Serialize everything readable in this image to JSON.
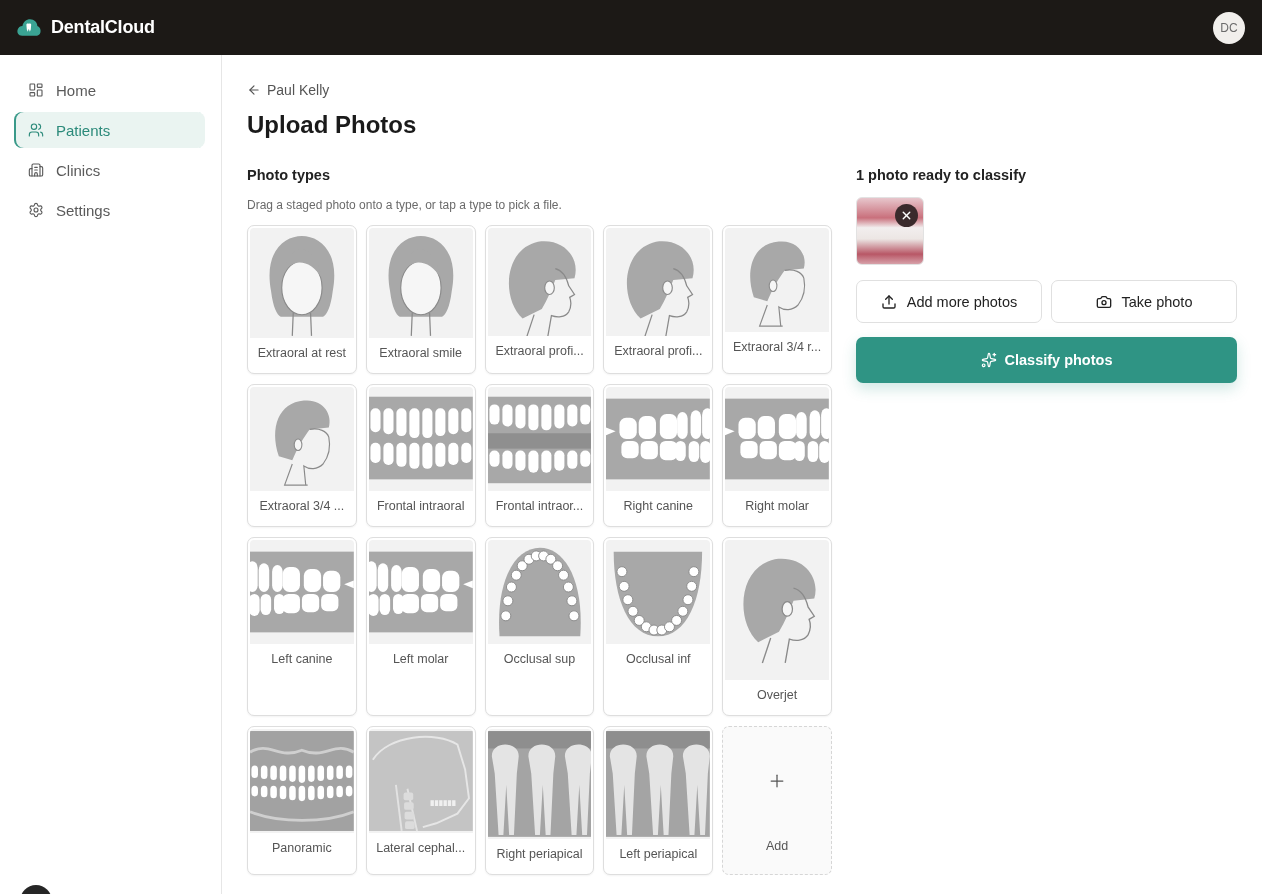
{
  "app": {
    "name": "DentalCloud",
    "user_initials": "DC"
  },
  "sidebar": {
    "items": [
      {
        "label": "Home",
        "selected": false
      },
      {
        "label": "Patients",
        "selected": true
      },
      {
        "label": "Clinics",
        "selected": false
      },
      {
        "label": "Settings",
        "selected": false
      }
    ]
  },
  "page": {
    "back_link": "Paul Kelly",
    "title": "Upload Photos"
  },
  "photo_types": {
    "heading": "Photo types",
    "hint": "Drag a staged photo onto a type, or tap a type to pick a file.",
    "tiles": [
      {
        "label": "Extraoral at rest",
        "kind": "face-front"
      },
      {
        "label": "Extraoral smile",
        "kind": "face-front"
      },
      {
        "label": "Extraoral profi...",
        "kind": "face-profile"
      },
      {
        "label": "Extraoral profi...",
        "kind": "face-profile"
      },
      {
        "label": "Extraoral 3/4 r...",
        "kind": "face-three-quarter"
      },
      {
        "label": "Extraoral 3/4 ...",
        "kind": "face-three-quarter"
      },
      {
        "label": "Frontal intraoral",
        "kind": "teeth-front"
      },
      {
        "label": "Frontal intraor...",
        "kind": "teeth-open"
      },
      {
        "label": "Right canine",
        "kind": "teeth-right"
      },
      {
        "label": "Right molar",
        "kind": "teeth-right"
      },
      {
        "label": "Left canine",
        "kind": "teeth-left"
      },
      {
        "label": "Left molar",
        "kind": "teeth-left"
      },
      {
        "label": "Occlusal sup",
        "kind": "arch-upper"
      },
      {
        "label": "Occlusal inf",
        "kind": "arch-lower"
      },
      {
        "label": "Overjet",
        "kind": "overjet"
      },
      {
        "label": "Panoramic",
        "kind": "xray-panoramic"
      },
      {
        "label": "Lateral cephal...",
        "kind": "xray-ceph"
      },
      {
        "label": "Right periapical",
        "kind": "xray-periapical"
      },
      {
        "label": "Left periapical",
        "kind": "xray-periapical"
      },
      {
        "label": "Add",
        "kind": "add"
      }
    ]
  },
  "staging": {
    "heading": "1 photo ready to classify",
    "photos": [
      {
        "kind": "intraoral"
      }
    ],
    "actions": [
      {
        "label": "Add more photos",
        "kind": "upload"
      },
      {
        "label": "Take photo",
        "kind": "camera"
      }
    ],
    "primary_action": {
      "label": "Classify photos"
    }
  }
}
